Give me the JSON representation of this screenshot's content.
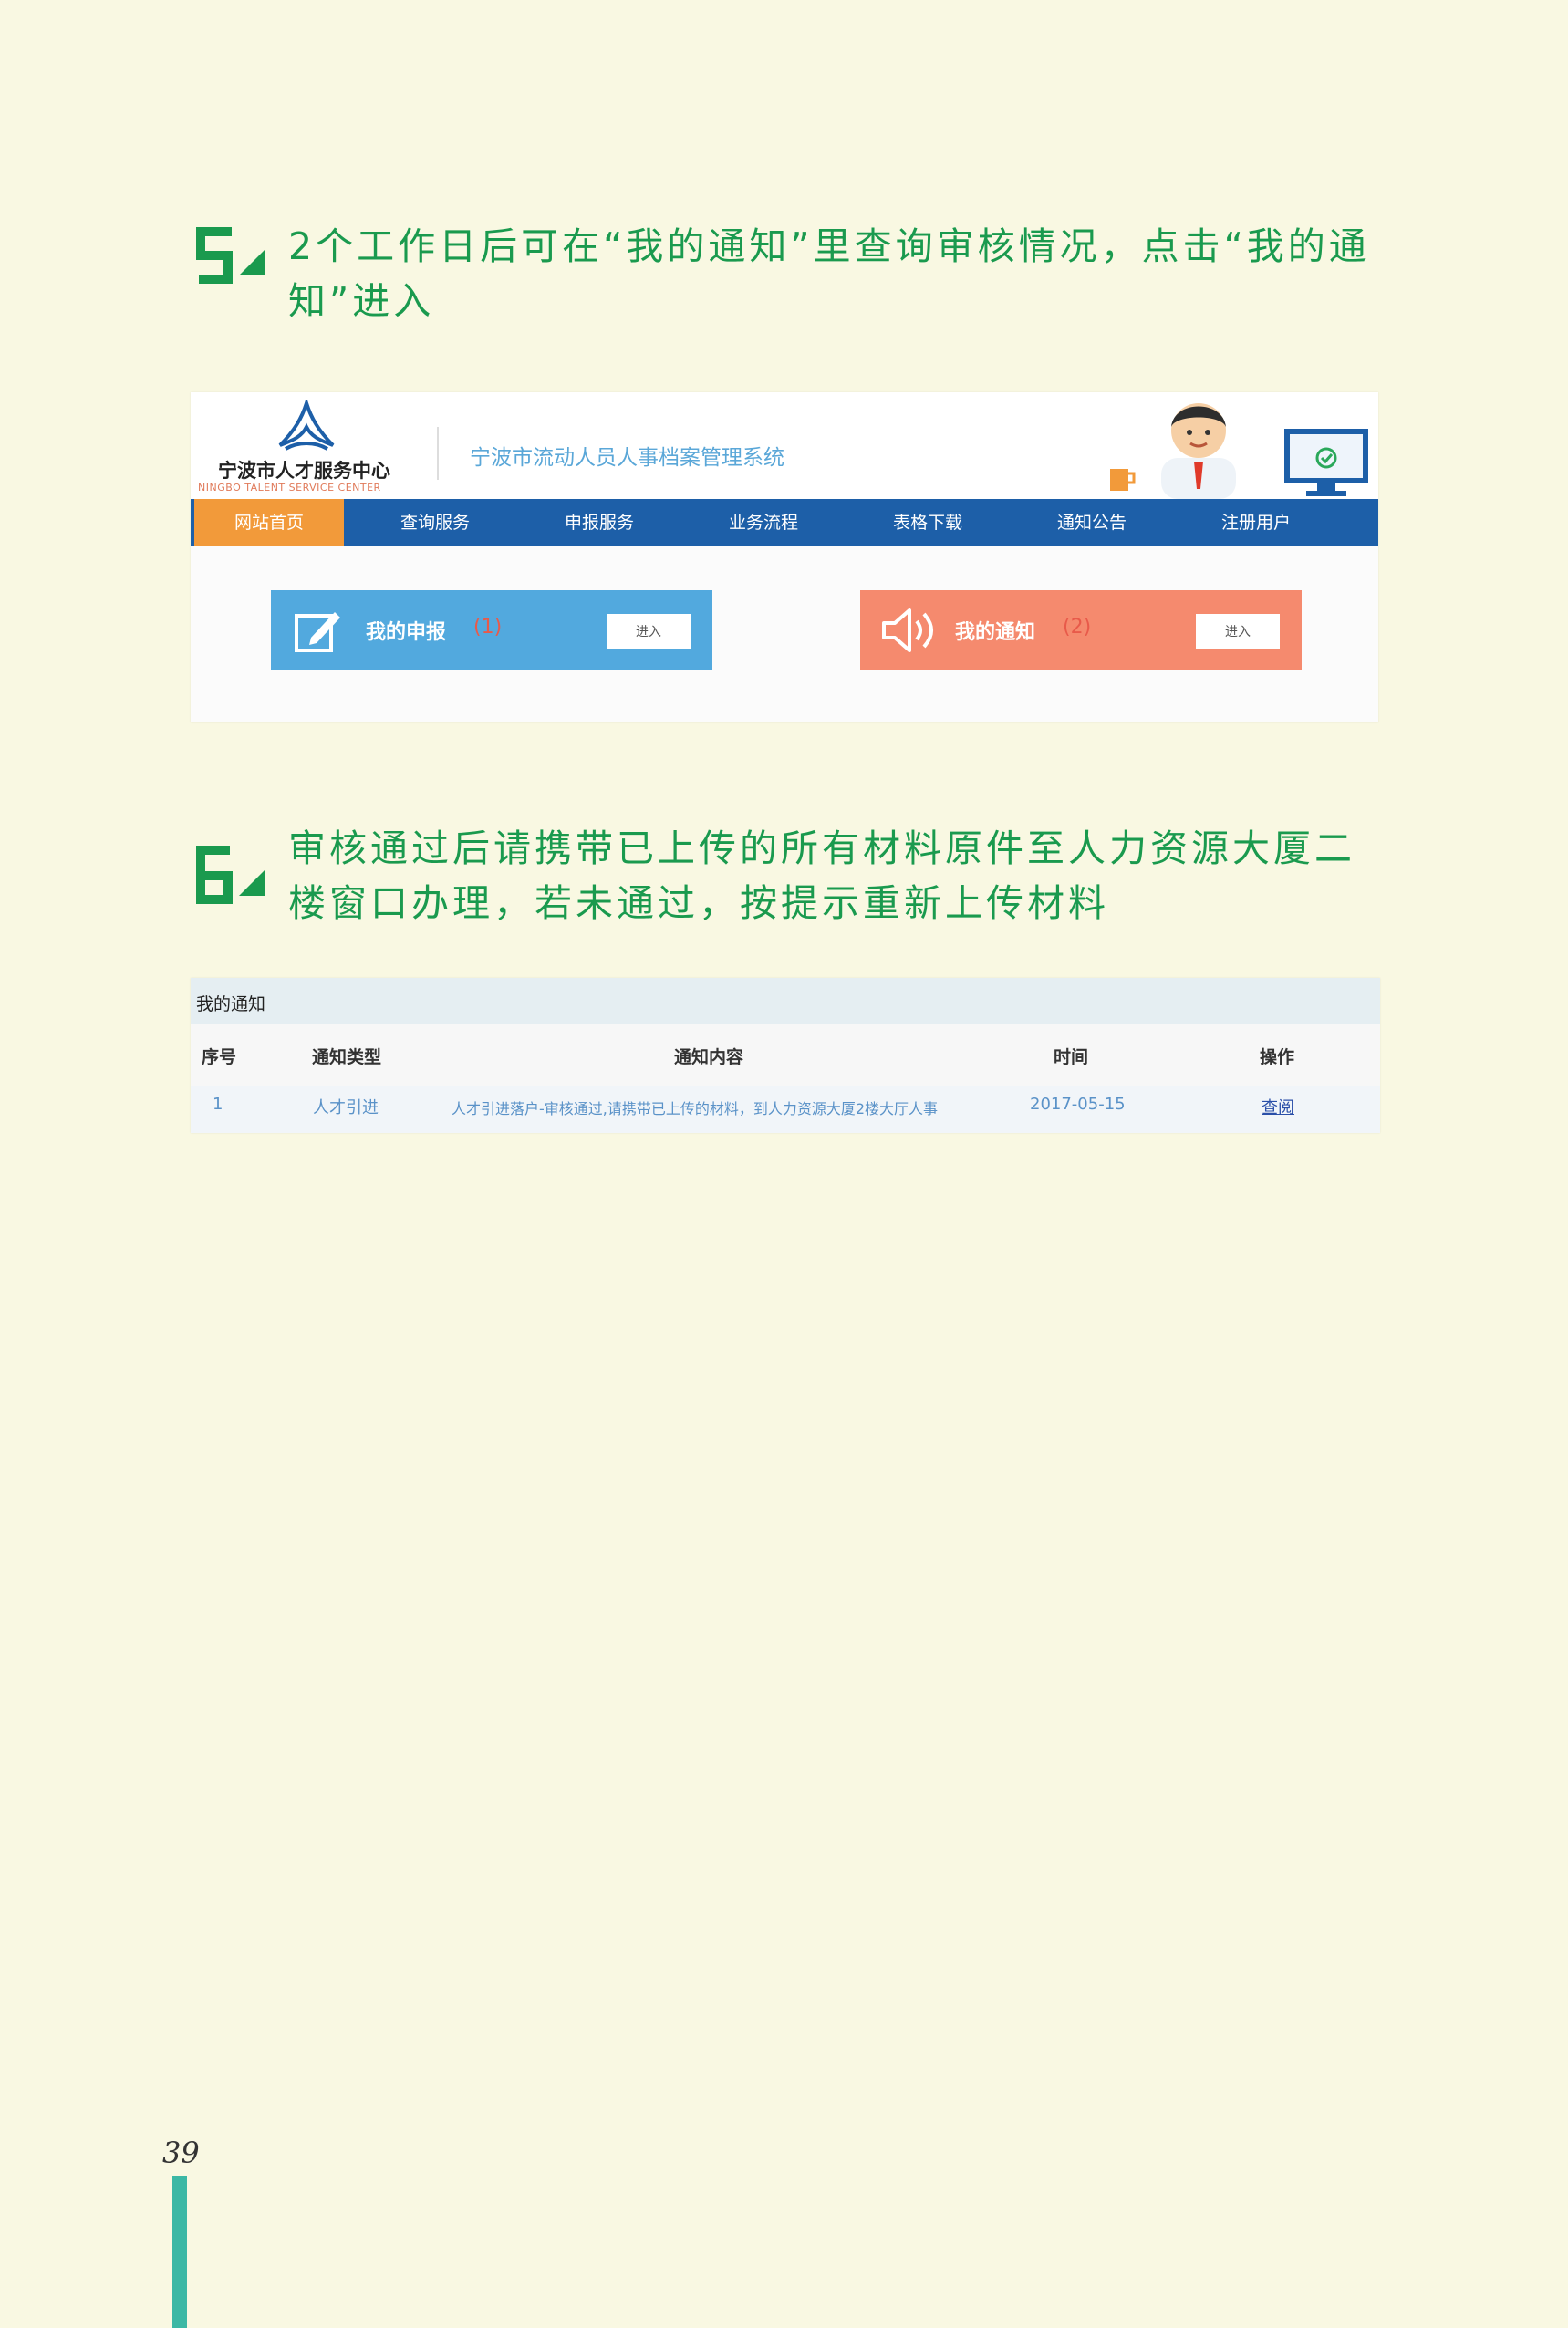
{
  "steps": [
    {
      "text": "2个工作日后可在“我的通知”里查询审核情况，点击“我的通知”进入"
    },
    {
      "text": "审核通过后请携带已上传的所有材料原件至人力资源大厦二楼窗口办理，若未通过，按提示重新上传材料"
    }
  ],
  "shot1": {
    "logo_text": "宁波市人才服务中心",
    "logo_sub": "NINGBO TALENT SERVICE CENTER",
    "system_title": "宁波市流动人员人事档案管理系统",
    "nav": [
      "网站首页",
      "查询服务",
      "申报服务",
      "业务流程",
      "表格下载",
      "通知公告",
      "注册用户"
    ],
    "cards": [
      {
        "label": "我的申报",
        "count": "(1)",
        "button": "进入",
        "color": "#52a9de",
        "icon": "edit-icon"
      },
      {
        "label": "我的通知",
        "count": "(2)",
        "button": "进入",
        "color": "#f58a6e",
        "icon": "speaker-icon"
      }
    ]
  },
  "shot2": {
    "title": "我的通知",
    "headers": [
      "序号",
      "通知类型",
      "通知内容",
      "时间",
      "操作"
    ],
    "row": [
      "1",
      "人才引进",
      "人才引进落户-审核通过,请携带已上传的材料，到人力资源大厦2楼大厅人事",
      "2017-05-15",
      "查阅"
    ]
  },
  "page_number": "39",
  "colors": {
    "accent": "#1a9a4e",
    "bg": "#f9f8e2",
    "nav": "#1d5fa8",
    "active": "#f29a3a"
  }
}
